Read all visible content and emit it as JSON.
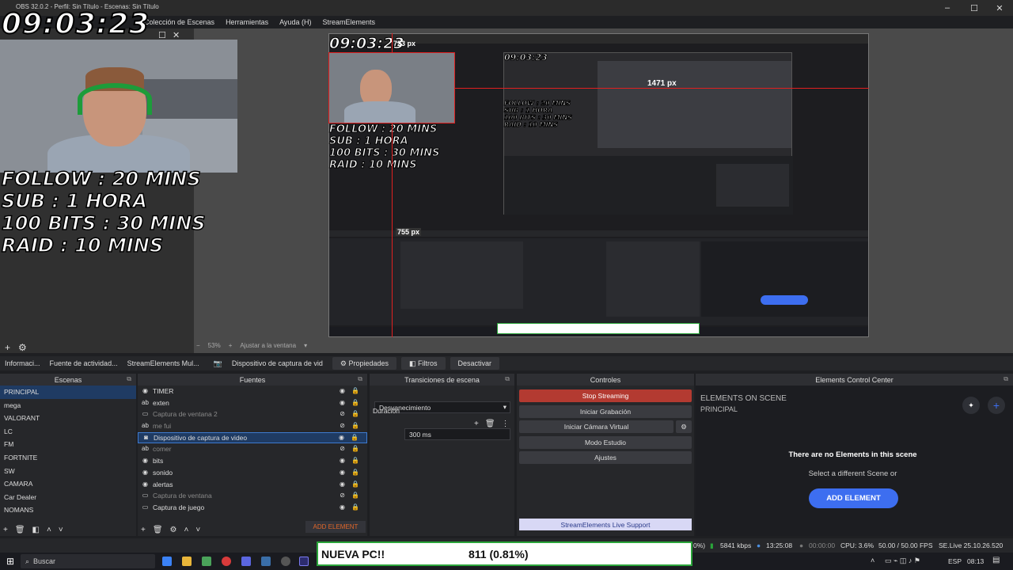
{
  "window": {
    "title": "OBS 32.0.2 - Perfil: Sin Título - Escenas: Sin Título"
  },
  "menu": [
    "Colección de Escenas",
    "Herramientas",
    "Ayuda (H)",
    "StreamElements"
  ],
  "overlay": {
    "timer": "09:03:23",
    "rules": [
      "FOLLOW : 20 MINS",
      "SUB : 1 HORA",
      "100 BITS : 30 MINS",
      "RAID : 10 MINS"
    ]
  },
  "canvas": {
    "measure_1": "723 px",
    "measure_2": "1471 px",
    "measure_3": "755 px"
  },
  "zoom": {
    "level": "53%",
    "fit": "Ajustar a la ventana"
  },
  "context_tabs": [
    "Informaci...",
    "Fuente de actividad...",
    "StreamElements Mul..."
  ],
  "context_bar": {
    "source": "Dispositivo de captura de vid",
    "props": "Propiedades",
    "filters": "Filtros",
    "deactivate": "Desactivar"
  },
  "scenes": {
    "title": "Escenas",
    "items": [
      "PRINCIPAL",
      "mega",
      "VALORANT",
      "LC",
      "FM",
      "FORTNITE",
      "SW",
      "CAMARA",
      "Car Dealer",
      "NOMANS"
    ]
  },
  "sources": {
    "title": "Fuentes",
    "items": [
      {
        "name": "TIMER",
        "icon": "globe-icon",
        "hidden": false
      },
      {
        "name": "exten",
        "icon": "text-icon",
        "hidden": false
      },
      {
        "name": "Captura de ventana 2",
        "icon": "window-icon",
        "hidden": true
      },
      {
        "name": "me fui",
        "icon": "text-icon",
        "hidden": true
      },
      {
        "name": "Dispositivo de captura de video",
        "icon": "camera-icon",
        "hidden": false,
        "selected": true
      },
      {
        "name": "comer",
        "icon": "text-icon",
        "hidden": true
      },
      {
        "name": "bits",
        "icon": "globe-icon",
        "hidden": false
      },
      {
        "name": "sonido",
        "icon": "globe-icon",
        "hidden": false
      },
      {
        "name": "alertas",
        "icon": "globe-icon",
        "hidden": false
      },
      {
        "name": "Captura de ventana",
        "icon": "window-icon",
        "hidden": true
      },
      {
        "name": "Captura de juego",
        "icon": "window-icon",
        "hidden": false
      }
    ],
    "add_element": "ADD ELEMENT"
  },
  "transitions": {
    "title": "Transiciones de escena",
    "type": "Desvanecimiento",
    "duration_label": "Duración",
    "duration_value": "300 ms"
  },
  "controls": {
    "title": "Controles",
    "buttons": [
      "Stop Streaming",
      "Iniciar Grabación",
      "Iniciar Cámara Virtual",
      "Modo Estudio",
      "Ajustes"
    ],
    "se_support": "StreamElements Live Support"
  },
  "ecc": {
    "title": "Elements Control Center",
    "heading": "ELEMENTS ON SCENE",
    "scene": "PRINCIPAL",
    "empty": "There are no Elements in this scene",
    "hint": "Select a different Scene or",
    "add": "ADD ELEMENT"
  },
  "status": {
    "dropped": "0%)",
    "bitrate": "5841 kbps",
    "live_time": "13:25:08",
    "rec_time": "00:00:00",
    "cpu": "CPU: 3.6%",
    "fps": "50.00 / 50.00 FPS",
    "se_version": "SE.Live 25.10.26.520"
  },
  "banner": {
    "title": "NUEVA PC!!",
    "value": "811 (0.81%)"
  },
  "taskbar": {
    "search": "Buscar",
    "lang": "ESP",
    "time": "08:13"
  },
  "colors": {
    "accent": "#3d6ef0",
    "stop": "#b33a31",
    "selection": "#1f3b63",
    "measure": "#e02020"
  }
}
